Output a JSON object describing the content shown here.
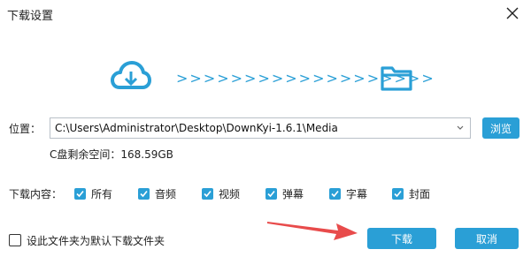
{
  "window": {
    "title": "下载设置"
  },
  "hero": {
    "arrows": ">>>>>>>>>>>>>>>>>>>"
  },
  "path": {
    "label": "位置：",
    "value": "C:\\Users\\Administrator\\Desktop\\DownKyi-1.6.1\\Media",
    "browse_label": "浏览"
  },
  "space": {
    "text": "C盘剩余空间：168.59GB"
  },
  "content": {
    "label": "下载内容：",
    "options": [
      {
        "label": "所有",
        "checked": true
      },
      {
        "label": "音频",
        "checked": true
      },
      {
        "label": "视频",
        "checked": true
      },
      {
        "label": "弹幕",
        "checked": true
      },
      {
        "label": "字幕",
        "checked": true
      },
      {
        "label": "封面",
        "checked": true
      }
    ]
  },
  "default_option": {
    "label": "设此文件夹为默认下载文件夹",
    "checked": false
  },
  "actions": {
    "download_label": "下载",
    "cancel_label": "取消"
  },
  "colors": {
    "accent": "#2a9fd6",
    "pointer": "#e84b4b"
  },
  "icons": {
    "cloud": "cloud-download-icon",
    "folder": "folder-icon",
    "close": "close-icon"
  }
}
